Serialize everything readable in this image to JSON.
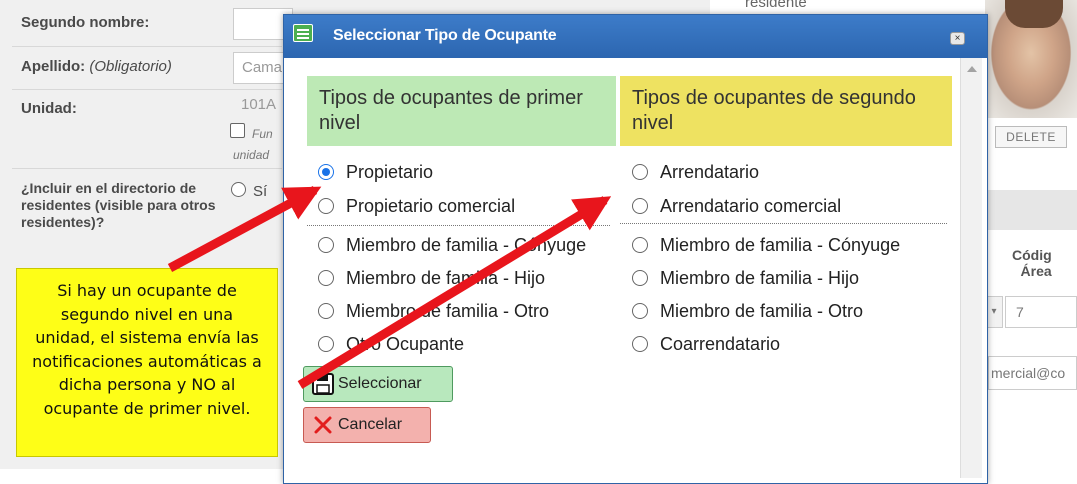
{
  "background_form": {
    "segundo_nombre_label": "Segundo nombre:",
    "apellido_label": "Apellido:",
    "apellido_hint": "(Obligatorio)",
    "apellido_value": "Cama",
    "unidad_label": "Unidad:",
    "unidad_value": "101A",
    "unidad_checkbox_label_1": "Fun",
    "unidad_checkbox_label_2": "unidad",
    "directorio_label": "¿Incluir en el directorio de residentes (visible para otros residentes)?",
    "directorio_option": "Sí",
    "top_right_fragment": "residente",
    "delete_label": "DELETE",
    "codigo_label_1": "Códig",
    "codigo_label_2": "Área",
    "area_value": "7",
    "email_fragment": "mercial@co"
  },
  "dialog": {
    "title": "Seleccionar Tipo de Ocupante",
    "close_label": "×",
    "column_1": {
      "header": "Tipos de ocupantes de primer nivel",
      "options": [
        {
          "label": "Propietario",
          "checked": true
        },
        {
          "label": "Propietario comercial",
          "checked": false
        },
        {
          "label": "Miembro de familia - Cónyuge",
          "checked": false
        },
        {
          "label": "Miembro de familia - Hijo",
          "checked": false
        },
        {
          "label": "Miembro de familia - Otro",
          "checked": false
        },
        {
          "label": "Otro Ocupante",
          "checked": false
        }
      ]
    },
    "column_2": {
      "header": "Tipos de ocupantes de segundo nivel",
      "options": [
        {
          "label": "Arrendatario",
          "checked": false
        },
        {
          "label": "Arrendatario comercial",
          "checked": false
        },
        {
          "label": "Miembro de familia - Cónyuge",
          "checked": false
        },
        {
          "label": "Miembro de familia - Hijo",
          "checked": false
        },
        {
          "label": "Miembro de familia - Otro",
          "checked": false
        },
        {
          "label": "Coarrendatario",
          "checked": false
        }
      ]
    },
    "select_button": "Seleccionar",
    "cancel_button": "Cancelar"
  },
  "annotation": {
    "text": "Si hay un ocupante de segundo nivel en una unidad, el sistema envía las notificaciones automáticas a dicha persona y NO al ocupante de primer nivel."
  },
  "colors": {
    "title_bar": "#2f6bb8",
    "first_level_header": "#bde9b5",
    "second_level_header": "#eee261",
    "annotation_bg": "#fefe17",
    "arrow": "#e8151c",
    "select_button": "#b8e8bd",
    "cancel_button": "#f3b1ad"
  }
}
